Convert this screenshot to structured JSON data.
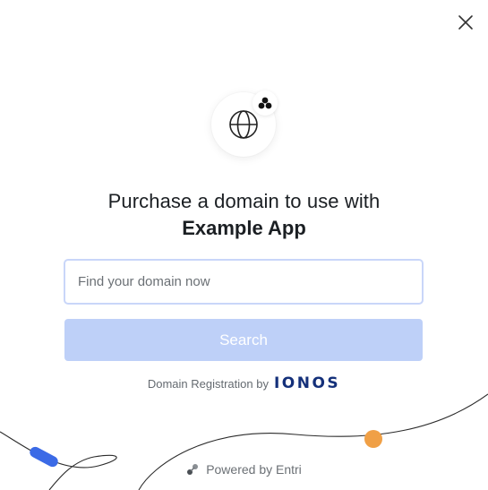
{
  "dialog": {
    "close_icon": "close-icon",
    "logo_icon": "globe-icon",
    "badge_icon": "app-cluster-icon"
  },
  "title": {
    "line1": "Purchase a domain to use with",
    "app_name": "Example App"
  },
  "search": {
    "placeholder": "Find your domain now",
    "value": "",
    "button_label": "Search"
  },
  "registration": {
    "prefix": "Domain Registration by",
    "provider": "IONOS"
  },
  "footer": {
    "icon": "entri-logo-icon",
    "label": "Powered by Entri"
  },
  "colors": {
    "accent_blue": "#3b6ae6",
    "accent_orange": "#f0a046",
    "button_disabled": "#bed0f8",
    "input_border": "#c9d6f9",
    "provider_navy": "#14307a"
  }
}
